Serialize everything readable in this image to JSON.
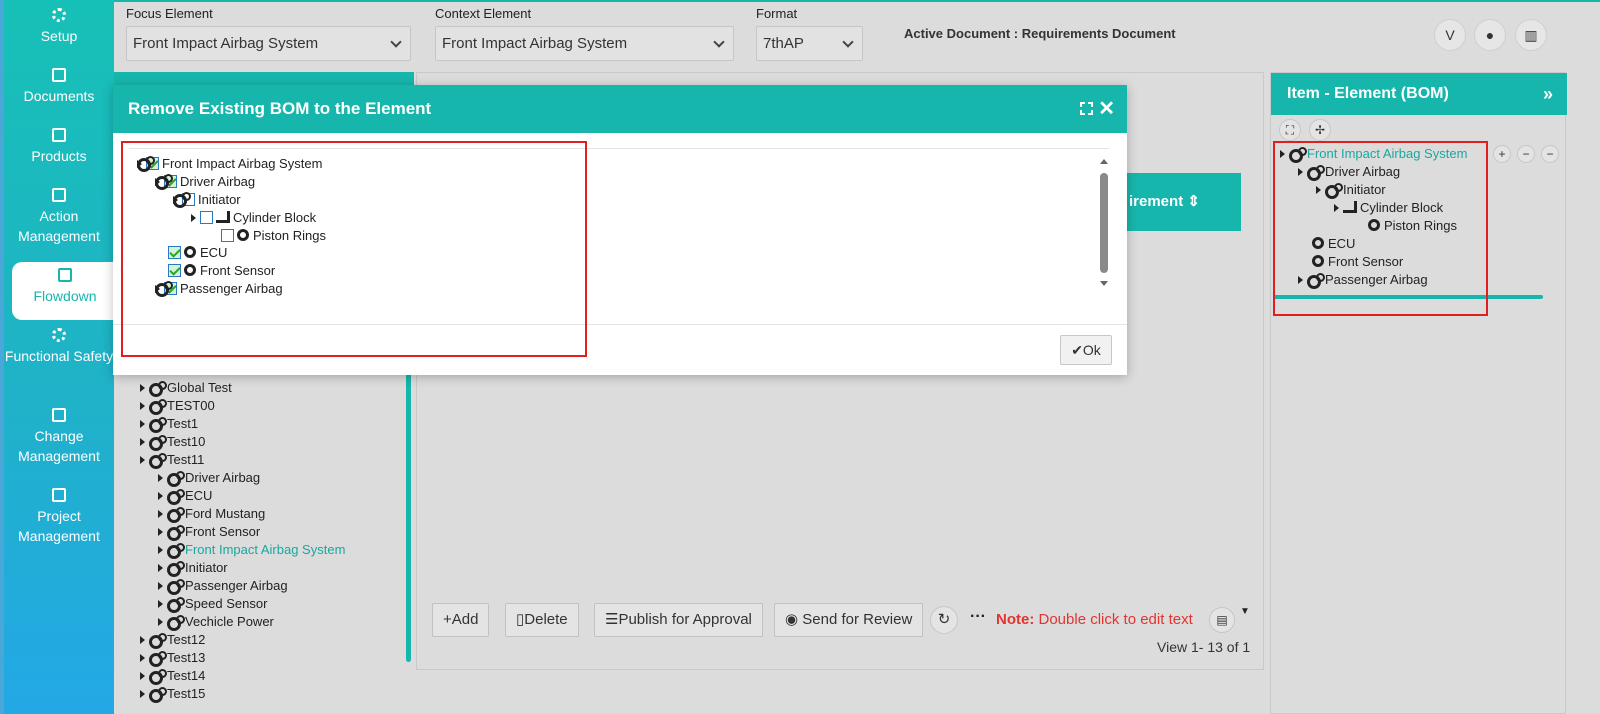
{
  "nav": {
    "items": [
      {
        "label": "Setup",
        "icon": "gears-icon"
      },
      {
        "label": "Documents",
        "icon": "documents-icon"
      },
      {
        "label": "Products",
        "icon": "products-icon"
      },
      {
        "label": "Action Management",
        "icon": "building-icon"
      },
      {
        "label": "Flowdown",
        "icon": "building-icon",
        "active": true
      },
      {
        "label": "Functional Safety",
        "icon": "safety-icon"
      },
      {
        "label": "Change Management",
        "icon": "building-icon"
      },
      {
        "label": "Project Management",
        "icon": "sitemap-icon"
      }
    ]
  },
  "topbar": {
    "focus_label": "Focus Element",
    "focus_value": "Front Impact Airbag System",
    "context_label": "Context Element",
    "context_value": "Front Impact Airbag System",
    "format_label": "Format",
    "format_value": "7thAP",
    "active_document": "Active Document : Requirements Document",
    "buttons": [
      "vine-icon",
      "drop-icon",
      "chart-icon"
    ]
  },
  "left_tree": {
    "rows": [
      {
        "label": "Global Test",
        "level": 0
      },
      {
        "label": "TEST00",
        "level": 0
      },
      {
        "label": "Test1",
        "level": 0
      },
      {
        "label": "Test10",
        "level": 0
      },
      {
        "label": "Test11",
        "level": 0
      },
      {
        "label": "Driver Airbag",
        "level": 1
      },
      {
        "label": "ECU",
        "level": 1
      },
      {
        "label": "Ford Mustang",
        "level": 1
      },
      {
        "label": "Front Sensor",
        "level": 1
      },
      {
        "label": "Front Impact Airbag System",
        "level": 1,
        "highlight": true
      },
      {
        "label": "Initiator",
        "level": 1
      },
      {
        "label": "Passenger Airbag",
        "level": 1
      },
      {
        "label": "Speed Sensor",
        "level": 1
      },
      {
        "label": "Vechicle Power",
        "level": 1
      },
      {
        "label": "Test12",
        "level": 0
      },
      {
        "label": "Test13",
        "level": 0
      },
      {
        "label": "Test14",
        "level": 0
      },
      {
        "label": "Test15",
        "level": 0
      }
    ]
  },
  "center": {
    "column_header": "irement",
    "toolbar": {
      "add": "Add",
      "delete": "Delete",
      "publish": "Publish for Approval",
      "send_review": "Send for Review"
    },
    "note_label": "Note:",
    "note_text": "Double click to edit text",
    "view_text": "View 1- 13 of 1"
  },
  "right_panel": {
    "title": "Item - Element (BOM)",
    "tree": [
      {
        "label": "Front Impact Airbag System",
        "level": 0,
        "highlight": true
      },
      {
        "label": "Driver Airbag",
        "level": 1
      },
      {
        "label": "Initiator",
        "level": 2
      },
      {
        "label": "Cylinder Block",
        "level": 3
      },
      {
        "label": "Piston Rings",
        "level": 4
      },
      {
        "label": "ECU",
        "level": 1
      },
      {
        "label": "Front Sensor",
        "level": 1
      },
      {
        "label": "Passenger Airbag",
        "level": 1
      }
    ]
  },
  "modal": {
    "title": "Remove Existing BOM to the Element",
    "ok_label": "Ok",
    "tree": [
      {
        "label": "Front Impact Airbag System",
        "level": 0,
        "checked": true
      },
      {
        "label": "Driver Airbag",
        "level": 1,
        "checked": true
      },
      {
        "label": "Initiator",
        "level": 2,
        "checked": false
      },
      {
        "label": "Cylinder Block",
        "level": 3,
        "checked": false
      },
      {
        "label": "Piston Rings",
        "level": 4,
        "checked": false
      },
      {
        "label": "ECU",
        "level": 1,
        "checked": true
      },
      {
        "label": "Front Sensor",
        "level": 1,
        "checked": true
      },
      {
        "label": "Passenger Airbag",
        "level": 1,
        "checked": true
      }
    ]
  },
  "colors": {
    "accent": "#17b6ac",
    "note": "#e3342f",
    "highlight_box": "#e02020"
  }
}
